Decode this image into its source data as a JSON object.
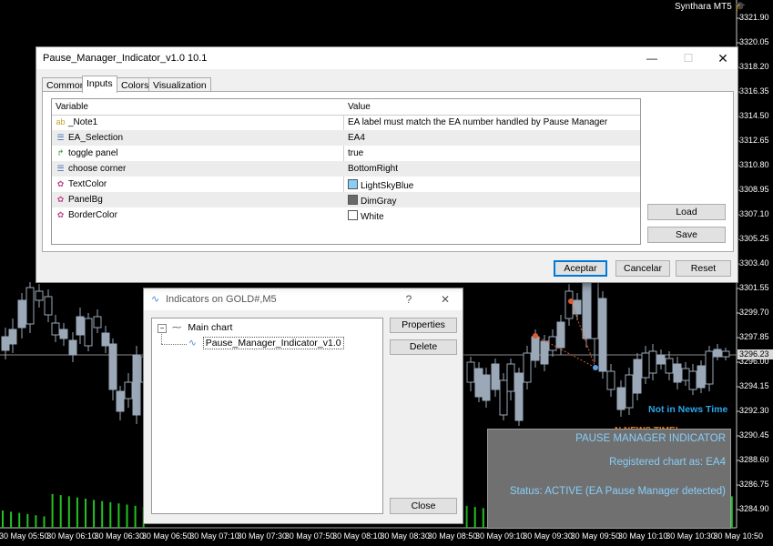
{
  "chart": {
    "brand": "Synthara MT5",
    "price_axis": [
      "3321.90",
      "3320.05",
      "3318.20",
      "3316.35",
      "3314.50",
      "3312.65",
      "3310.80",
      "3308.95",
      "3307.10",
      "3305.25",
      "3303.40",
      "3301.55",
      "3299.70",
      "3297.85",
      "3296.00",
      "3294.15",
      "3292.30",
      "3290.45",
      "3288.60",
      "3286.75",
      "3284.90"
    ],
    "current_price": "3296.23",
    "time_axis": [
      "30 May 05:50",
      "30 May 06:10",
      "30 May 06:30",
      "30 May 06:50",
      "30 May 07:10",
      "30 May 07:30",
      "30 May 07:50",
      "30 May 08:10",
      "30 May 08:30",
      "30 May 08:50",
      "30 May 09:10",
      "30 May 09:30",
      "30 May 09:50",
      "30 May 10:10",
      "30 May 10:30",
      "30 May 10:50"
    ],
    "news_status": "Not in News Time",
    "news_hidden": "N NEWS TIME!",
    "colors": {
      "bull": "#000000",
      "bear": "#9aa8b8",
      "volume": "#22c322",
      "panel_bg": "#707070",
      "panel_text": "#87cefa"
    }
  },
  "panel": {
    "title": "PAUSE MANAGER INDICATOR",
    "registered": "Registered chart as: EA4",
    "status": "Status: ACTIVE (EA Pause Manager detected)"
  },
  "properties_dialog": {
    "title": "Pause_Manager_Indicator_v1.0 10.1",
    "tabs": [
      "Common",
      "Inputs",
      "Colors",
      "Visualization"
    ],
    "active_tab": "Inputs",
    "columns": {
      "variable": "Variable",
      "value": "Value"
    },
    "rows": [
      {
        "icon": "ab",
        "icon_name": "string-icon",
        "variable": "_Note1",
        "value": "EA label must match the EA number handled by Pause Manager"
      },
      {
        "icon": "☰",
        "icon_name": "enum-icon",
        "variable": "EA_Selection",
        "value": "EA4"
      },
      {
        "icon": "↱",
        "icon_name": "bool-icon",
        "variable": "toggle panel",
        "value": "true"
      },
      {
        "icon": "☰",
        "icon_name": "enum-icon",
        "variable": "choose corner",
        "value": "BottomRight"
      },
      {
        "icon": "✿",
        "icon_name": "color-icon",
        "variable": "TextColor",
        "value": "LightSkyBlue",
        "swatch": "#87cefa"
      },
      {
        "icon": "✿",
        "icon_name": "color-icon",
        "variable": "PanelBg",
        "value": "DimGray",
        "swatch": "#696969"
      },
      {
        "icon": "✿",
        "icon_name": "color-icon",
        "variable": "BorderColor",
        "value": "White",
        "swatch": "#ffffff"
      }
    ],
    "buttons": {
      "load": "Load",
      "save": "Save",
      "accept": "Aceptar",
      "cancel": "Cancelar",
      "reset": "Reset"
    }
  },
  "indicators_dialog": {
    "title": "Indicators on GOLD#,M5",
    "help": "?",
    "tree": {
      "root": "Main chart",
      "child": "Pause_Manager_Indicator_v1.0"
    },
    "buttons": {
      "properties": "Properties",
      "delete": "Delete",
      "close": "Close"
    }
  }
}
